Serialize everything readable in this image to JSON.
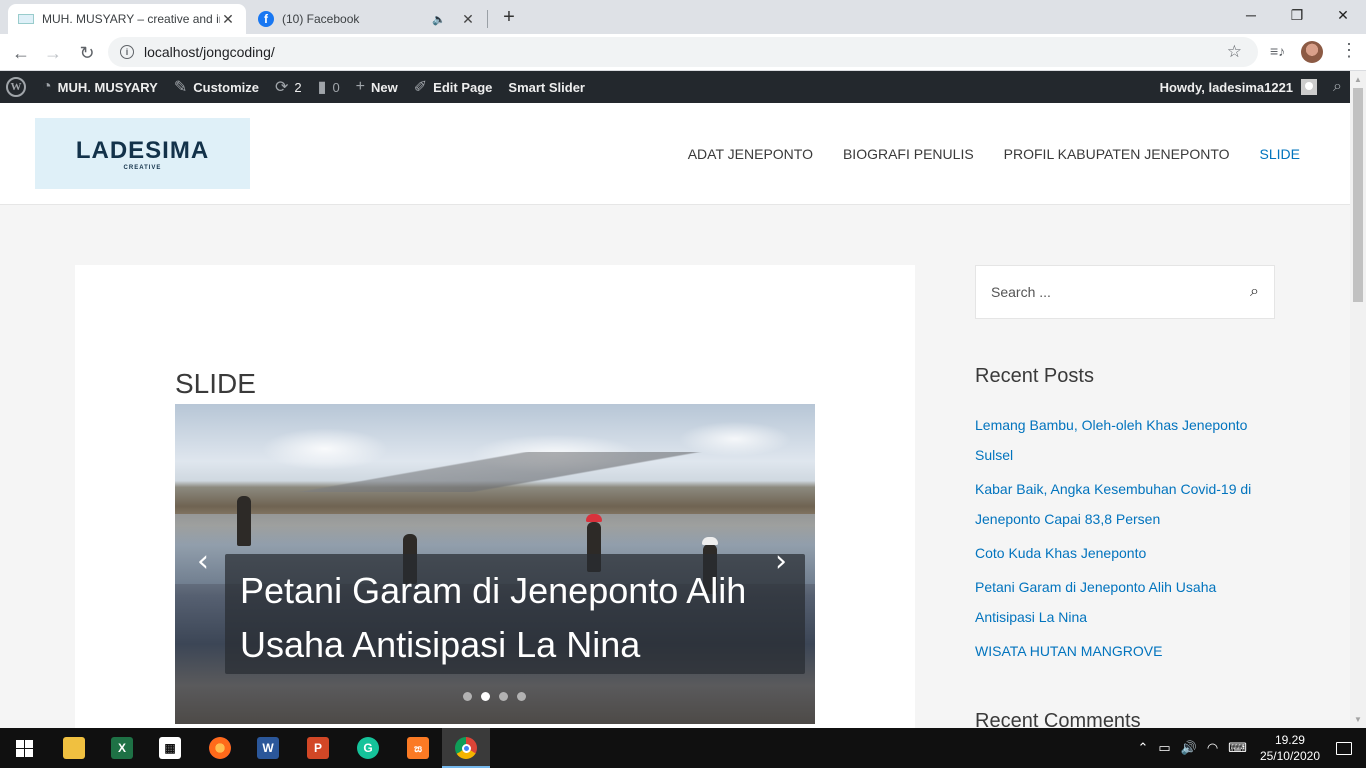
{
  "browser": {
    "tabs": [
      {
        "title": "MUH. MUSYARY – creative and in",
        "active": true
      },
      {
        "title": "(10) Facebook",
        "active": false
      }
    ],
    "url": "localhost/jongcoding/"
  },
  "adminbar": {
    "site_name": "MUH. MUSYARY",
    "customize": "Customize",
    "updates_count": "2",
    "comments_count": "0",
    "new_label": "New",
    "edit_page": "Edit Page",
    "smart_slider": "Smart Slider",
    "howdy": "Howdy, ladesima1221"
  },
  "site": {
    "logo_name": "LADESIMA",
    "logo_sub": "CREATIVE",
    "nav": [
      "ADAT JENEPONTO",
      "BIOGRAFI PENULIS",
      "PROFIL KABUPATEN JENEPONTO",
      "SLIDE"
    ],
    "current_nav": "SLIDE"
  },
  "content": {
    "page_title": "SLIDE",
    "slide": {
      "caption_line1": "Petani Garam di Jeneponto Alih",
      "caption_line2": "Usaha Antisipasi La Nina",
      "dots": 4,
      "active_dot": 2
    }
  },
  "sidebar": {
    "search_placeholder": "Search ...",
    "recent_posts_title": "Recent Posts",
    "recent_posts": [
      "Lemang Bambu, Oleh-oleh Khas Jeneponto Sulsel",
      "Kabar Baik, Angka Kesembuhan Covid-19 di Jeneponto Capai 83,8 Persen",
      "Coto Kuda Khas Jeneponto",
      "Petani Garam di Jeneponto Alih Usaha Antisipasi La Nina",
      "WISATA HUTAN MANGROVE"
    ],
    "recent_comments_title": "Recent Comments"
  },
  "taskbar": {
    "time": "19.29",
    "date": "25/10/2020"
  },
  "colors": {
    "link": "#0274be",
    "adminbar": "#23282d",
    "taskbar": "#101010"
  }
}
